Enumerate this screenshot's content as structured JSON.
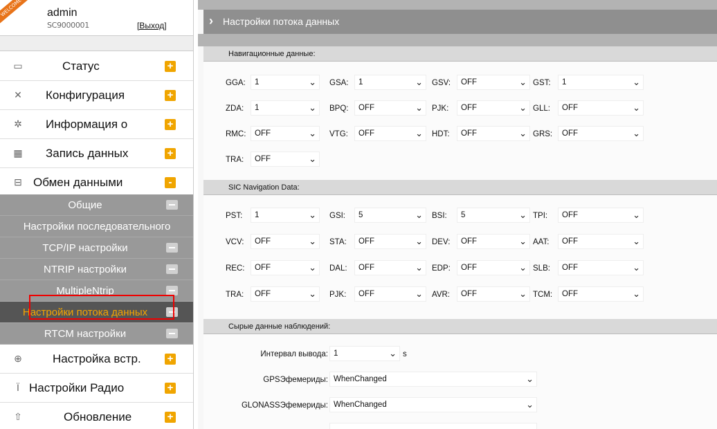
{
  "sidebar": {
    "ribbon": "WELCOME",
    "user": {
      "name": "admin",
      "sub": "SC9000001",
      "logout": "[Выход]"
    },
    "menu": [
      {
        "label": "Статус",
        "icon": "monitor-icon",
        "toggle": "+"
      },
      {
        "label": "Конфигурация",
        "icon": "tools-icon",
        "toggle": "+"
      },
      {
        "label": "Информация о",
        "icon": "satellite-icon",
        "toggle": "+"
      },
      {
        "label": "Запись данных",
        "icon": "chart-icon",
        "toggle": "+"
      },
      {
        "label": "Обмен данными",
        "icon": "network-icon",
        "toggle": "-"
      }
    ],
    "submenu": [
      {
        "label": "Общие"
      },
      {
        "label": "Настройки последовательного"
      },
      {
        "label": "TCP/IP настройки"
      },
      {
        "label": "NTRIP настройки"
      },
      {
        "label": "MultipleNtrip"
      },
      {
        "label": "Настройки потока данных"
      },
      {
        "label": "RTCM настройки"
      }
    ],
    "menu2": [
      {
        "label": "Настройка встр.",
        "icon": "globe-icon",
        "toggle": "+"
      },
      {
        "label": "Настройки Радио",
        "icon": "antenna-icon",
        "toggle": "+"
      },
      {
        "label": "Обновление",
        "icon": "upload-icon",
        "toggle": "+"
      }
    ]
  },
  "main": {
    "title": "Настройки потока данных",
    "nav": {
      "title": "Навигационные данные:",
      "rows": [
        [
          {
            "l": "GGA:",
            "v": "1"
          },
          {
            "l": "GSA:",
            "v": "1"
          },
          {
            "l": "GSV:",
            "v": "OFF"
          },
          {
            "l": "GST:",
            "v": "1"
          }
        ],
        [
          {
            "l": "ZDA:",
            "v": "1"
          },
          {
            "l": "BPQ:",
            "v": "OFF"
          },
          {
            "l": "PJK:",
            "v": "OFF"
          },
          {
            "l": "GLL:",
            "v": "OFF"
          }
        ],
        [
          {
            "l": "RMC:",
            "v": "OFF"
          },
          {
            "l": "VTG:",
            "v": "OFF"
          },
          {
            "l": "HDT:",
            "v": "OFF"
          },
          {
            "l": "GRS:",
            "v": "OFF"
          }
        ],
        [
          {
            "l": "TRA:",
            "v": "OFF"
          }
        ]
      ]
    },
    "sic": {
      "title": "SIC Navigation Data:",
      "rows": [
        [
          {
            "l": "PST:",
            "v": "1"
          },
          {
            "l": "GSI:",
            "v": "5"
          },
          {
            "l": "BSI:",
            "v": "5"
          },
          {
            "l": "TPI:",
            "v": "OFF"
          }
        ],
        [
          {
            "l": "VCV:",
            "v": "OFF"
          },
          {
            "l": "STA:",
            "v": "OFF"
          },
          {
            "l": "DEV:",
            "v": "OFF"
          },
          {
            "l": "AAT:",
            "v": "OFF"
          }
        ],
        [
          {
            "l": "REC:",
            "v": "OFF"
          },
          {
            "l": "DAL:",
            "v": "OFF"
          },
          {
            "l": "EDP:",
            "v": "OFF"
          },
          {
            "l": "SLB:",
            "v": "OFF"
          }
        ],
        [
          {
            "l": "TRA:",
            "v": "OFF"
          },
          {
            "l": "PJK:",
            "v": "OFF"
          },
          {
            "l": "AVR:",
            "v": "OFF"
          },
          {
            "l": "TCM:",
            "v": "OFF"
          }
        ]
      ]
    },
    "raw": {
      "title": "Сырые данные наблюдений:",
      "interval": {
        "label": "Интервал вывода:",
        "value": "1",
        "unit": "s"
      },
      "gps": {
        "label": "GPSЭфемериды:",
        "value": "WhenChanged"
      },
      "glonass": {
        "label": "GLONASSЭфемериды:",
        "value": "WhenChanged"
      }
    }
  }
}
